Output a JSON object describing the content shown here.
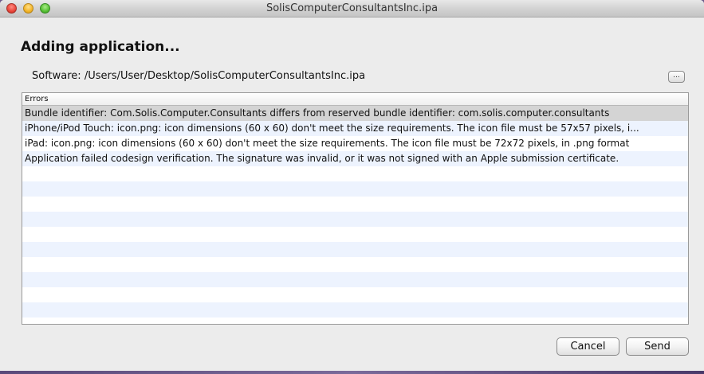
{
  "window": {
    "title": "SolisComputerConsultantsInc.ipa"
  },
  "dialog": {
    "heading": "Adding application...",
    "software_label": "Software:",
    "software_path": "/Users/User/Desktop/SolisComputerConsultantsInc.ipa",
    "browse_label": "..."
  },
  "errors": {
    "header": "Errors",
    "rows": [
      "Bundle identifier: Com.Solis.Computer.Consultants differs from reserved bundle identifier: com.solis.computer.consultants",
      "iPhone/iPod Touch: icon.png: icon dimensions (60 x 60) don't meet the size requirements.  The icon file must be 57x57 pixels, i...",
      "iPad: icon.png: icon dimensions (60 x 60) don't meet the size requirements.  The icon file must be 72x72 pixels, in .png format",
      "Application failed codesign verification.  The signature was invalid, or it was not signed with an Apple submission certificate.",
      "",
      "",
      "",
      "",
      "",
      "",
      "",
      "",
      "",
      ""
    ],
    "selected_index": 0
  },
  "buttons": {
    "cancel": "Cancel",
    "send": "Send"
  },
  "colors": {
    "row_alt": "#edf3fe",
    "row_selected": "#d4d4d4"
  }
}
